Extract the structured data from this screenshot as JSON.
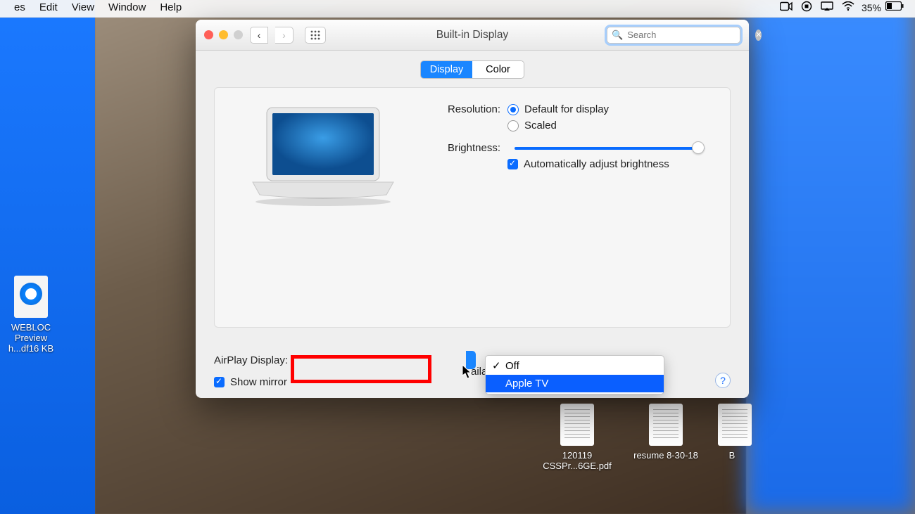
{
  "menubar": {
    "items": [
      "es",
      "Edit",
      "View",
      "Window",
      "Help"
    ],
    "battery_pct": "35%"
  },
  "desktop": {
    "webloc": {
      "label1": "WEBLOC",
      "label2": "Preview",
      "label3": "h...df16 KB"
    },
    "file1": "120119 CSSPr...6GE.pdf",
    "file2": "resume 8-30-18",
    "file3": "B"
  },
  "window": {
    "title": "Built-in Display",
    "search_placeholder": "Search"
  },
  "tabs": {
    "display": "Display",
    "color": "Color"
  },
  "settings": {
    "resolution_label": "Resolution:",
    "res_opt1": "Default for display",
    "res_opt2": "Scaled",
    "brightness_label": "Brightness:",
    "auto_brightness": "Automatically adjust brightness"
  },
  "airplay": {
    "label": "AirPlay Display:",
    "options": [
      "Off",
      "Apple TV"
    ],
    "selected": "Off",
    "show_mirroring": "Show mirror",
    "mirroring_tail": "ailable"
  },
  "help": "?"
}
